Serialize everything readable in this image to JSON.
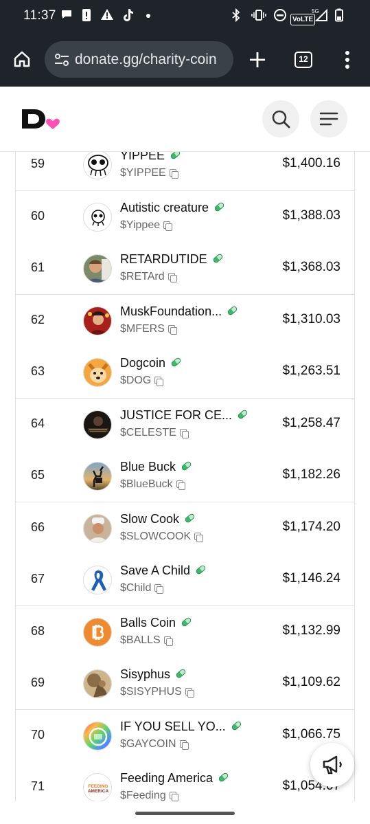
{
  "status_bar": {
    "time": "11:37",
    "icons": [
      "chat-bubble-icon",
      "alert-card-icon",
      "warning-icon",
      "tiktok-icon",
      "dot-icon",
      "bluetooth-icon",
      "vibrate-icon",
      "do-not-disturb-icon",
      "volte-icon",
      "signal-5g-icon",
      "battery-icon"
    ],
    "volte_label": "VoLTE",
    "network_label": "5G"
  },
  "browser": {
    "url": "donate.gg/charity-coin",
    "tab_count": "12"
  },
  "site_header": {
    "logo_letter": "D",
    "brand_color": "#ff4fb6"
  },
  "rows": [
    {
      "rank": "59",
      "name": "YIPPEE",
      "ticker": "$YIPPEE",
      "amount": "$1,400.16"
    },
    {
      "rank": "60",
      "name": "Autistic creature",
      "ticker": "$Yippee",
      "amount": "$1,388.03"
    },
    {
      "rank": "61",
      "name": "RETARDUTIDE",
      "ticker": "$RETArd",
      "amount": "$1,368.03"
    },
    {
      "rank": "62",
      "name": "MuskFoundation...",
      "ticker": "$MFERS",
      "amount": "$1,310.03"
    },
    {
      "rank": "63",
      "name": "Dogcoin",
      "ticker": "$DOG",
      "amount": "$1,263.51"
    },
    {
      "rank": "64",
      "name": "JUSTICE FOR CE...",
      "ticker": "$CELESTE",
      "amount": "$1,258.47"
    },
    {
      "rank": "65",
      "name": "Blue Buck",
      "ticker": "$BlueBuck",
      "amount": "$1,182.26"
    },
    {
      "rank": "66",
      "name": "Slow Cook",
      "ticker": "$SLOWCOOK",
      "amount": "$1,174.20"
    },
    {
      "rank": "67",
      "name": "Save A Child",
      "ticker": "$Child",
      "amount": "$1,146.24"
    },
    {
      "rank": "68",
      "name": "Balls Coin",
      "ticker": "$BALLS",
      "amount": "$1,132.99"
    },
    {
      "rank": "69",
      "name": "Sisyphus",
      "ticker": "$SISYPHUS",
      "amount": "$1,109.62"
    },
    {
      "rank": "70",
      "name": "IF YOU SELL YO...",
      "ticker": "$GAYCOIN",
      "amount": "$1,066.75"
    },
    {
      "rank": "71",
      "name": "Feeding America",
      "ticker": "$Feeding",
      "amount": "$1,054.67"
    }
  ],
  "avatars": [
    "yippee-creature-icon",
    "skull-creature-icon",
    "man-portrait-icon",
    "red-portrait-icon",
    "shiba-dog-icon",
    "dark-portrait-icon",
    "deer-silhouette-icon",
    "chef-portrait-icon",
    "blue-ribbon-icon",
    "bitcoin-ball-icon",
    "sisyphus-sculpture-icon",
    "rainbow-coin-icon",
    "feeding-america-logo-icon"
  ],
  "feeding_logo_text": "FEEDING AMERICA",
  "fab": {
    "icon": "megaphone-icon"
  }
}
